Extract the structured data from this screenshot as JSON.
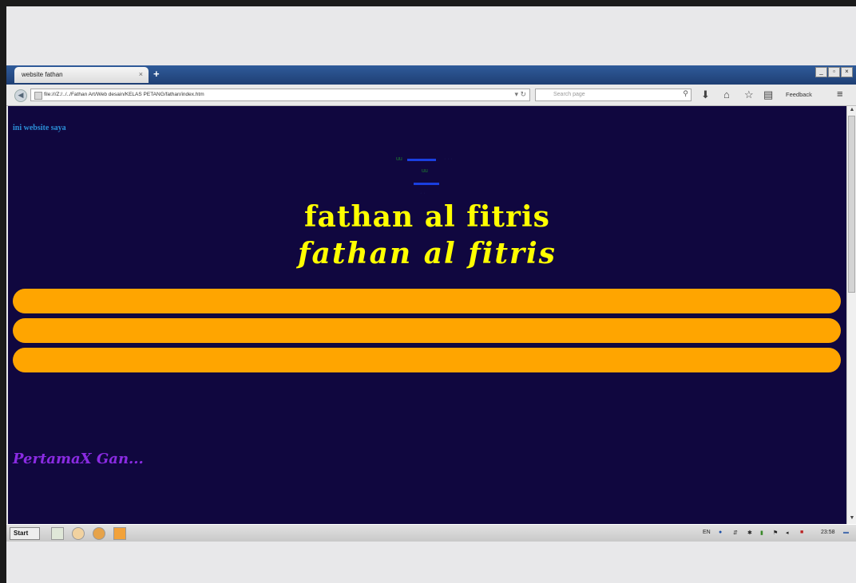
{
  "browser": {
    "tab_title": "website fathan",
    "tab_close": "×",
    "new_tab": "+",
    "window_buttons": [
      "_",
      "▫",
      "×"
    ],
    "url": "file:///Z:/../../Fathan Art/Web desain/KELAS PETANG/fathan/index.htm",
    "search_placeholder": "Search page",
    "feedback_label": "Feedback",
    "toolbar_icons": [
      "download-icon",
      "home-icon",
      "star-icon",
      "reading-list-icon"
    ]
  },
  "page": {
    "site_title": "ini website saya",
    "nav_line1": "uu",
    "nav_line2": "uu",
    "heading1": "fathan al fitris",
    "heading2": "fathan al fitris",
    "footer_text": "PertamaX Gan..."
  },
  "taskbar": {
    "start_label": "Start",
    "lang": "EN",
    "clock": "23:58"
  },
  "colors": {
    "page_bg": "#10073f",
    "heading": "#ffff00",
    "pill": "#ffa500",
    "footer": "#8a2be2",
    "site_title": "#2b8fd8"
  }
}
